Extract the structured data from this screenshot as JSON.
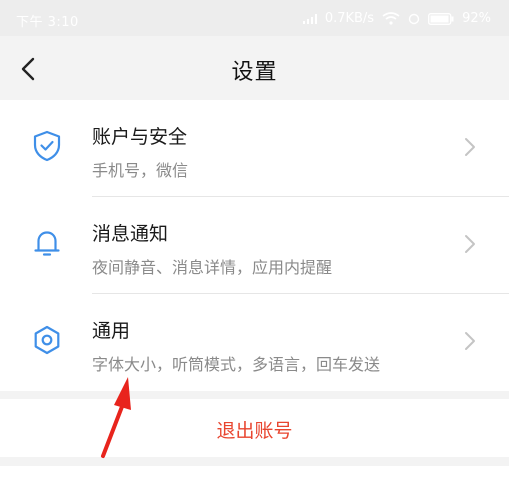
{
  "status_bar": {
    "time": "下午 3:10",
    "speed": "0.7KB/s",
    "battery": "92%"
  },
  "header": {
    "title": "设置"
  },
  "settings_items": [
    {
      "title": "账户与安全",
      "subtitle": "手机号，微信",
      "icon": "shield-check-icon"
    },
    {
      "title": "消息通知",
      "subtitle": "夜间静音、消息详情，应用内提醒",
      "icon": "bell-icon"
    },
    {
      "title": "通用",
      "subtitle": "字体大小，听筒模式，多语言，回车发送",
      "icon": "gear-icon"
    }
  ],
  "logout": {
    "label": "退出账号"
  },
  "colors": {
    "accent_blue": "#3f8fe8",
    "logout_red": "#e8452f",
    "annotation_red": "#e8241d",
    "background": "#f3f3f3"
  }
}
